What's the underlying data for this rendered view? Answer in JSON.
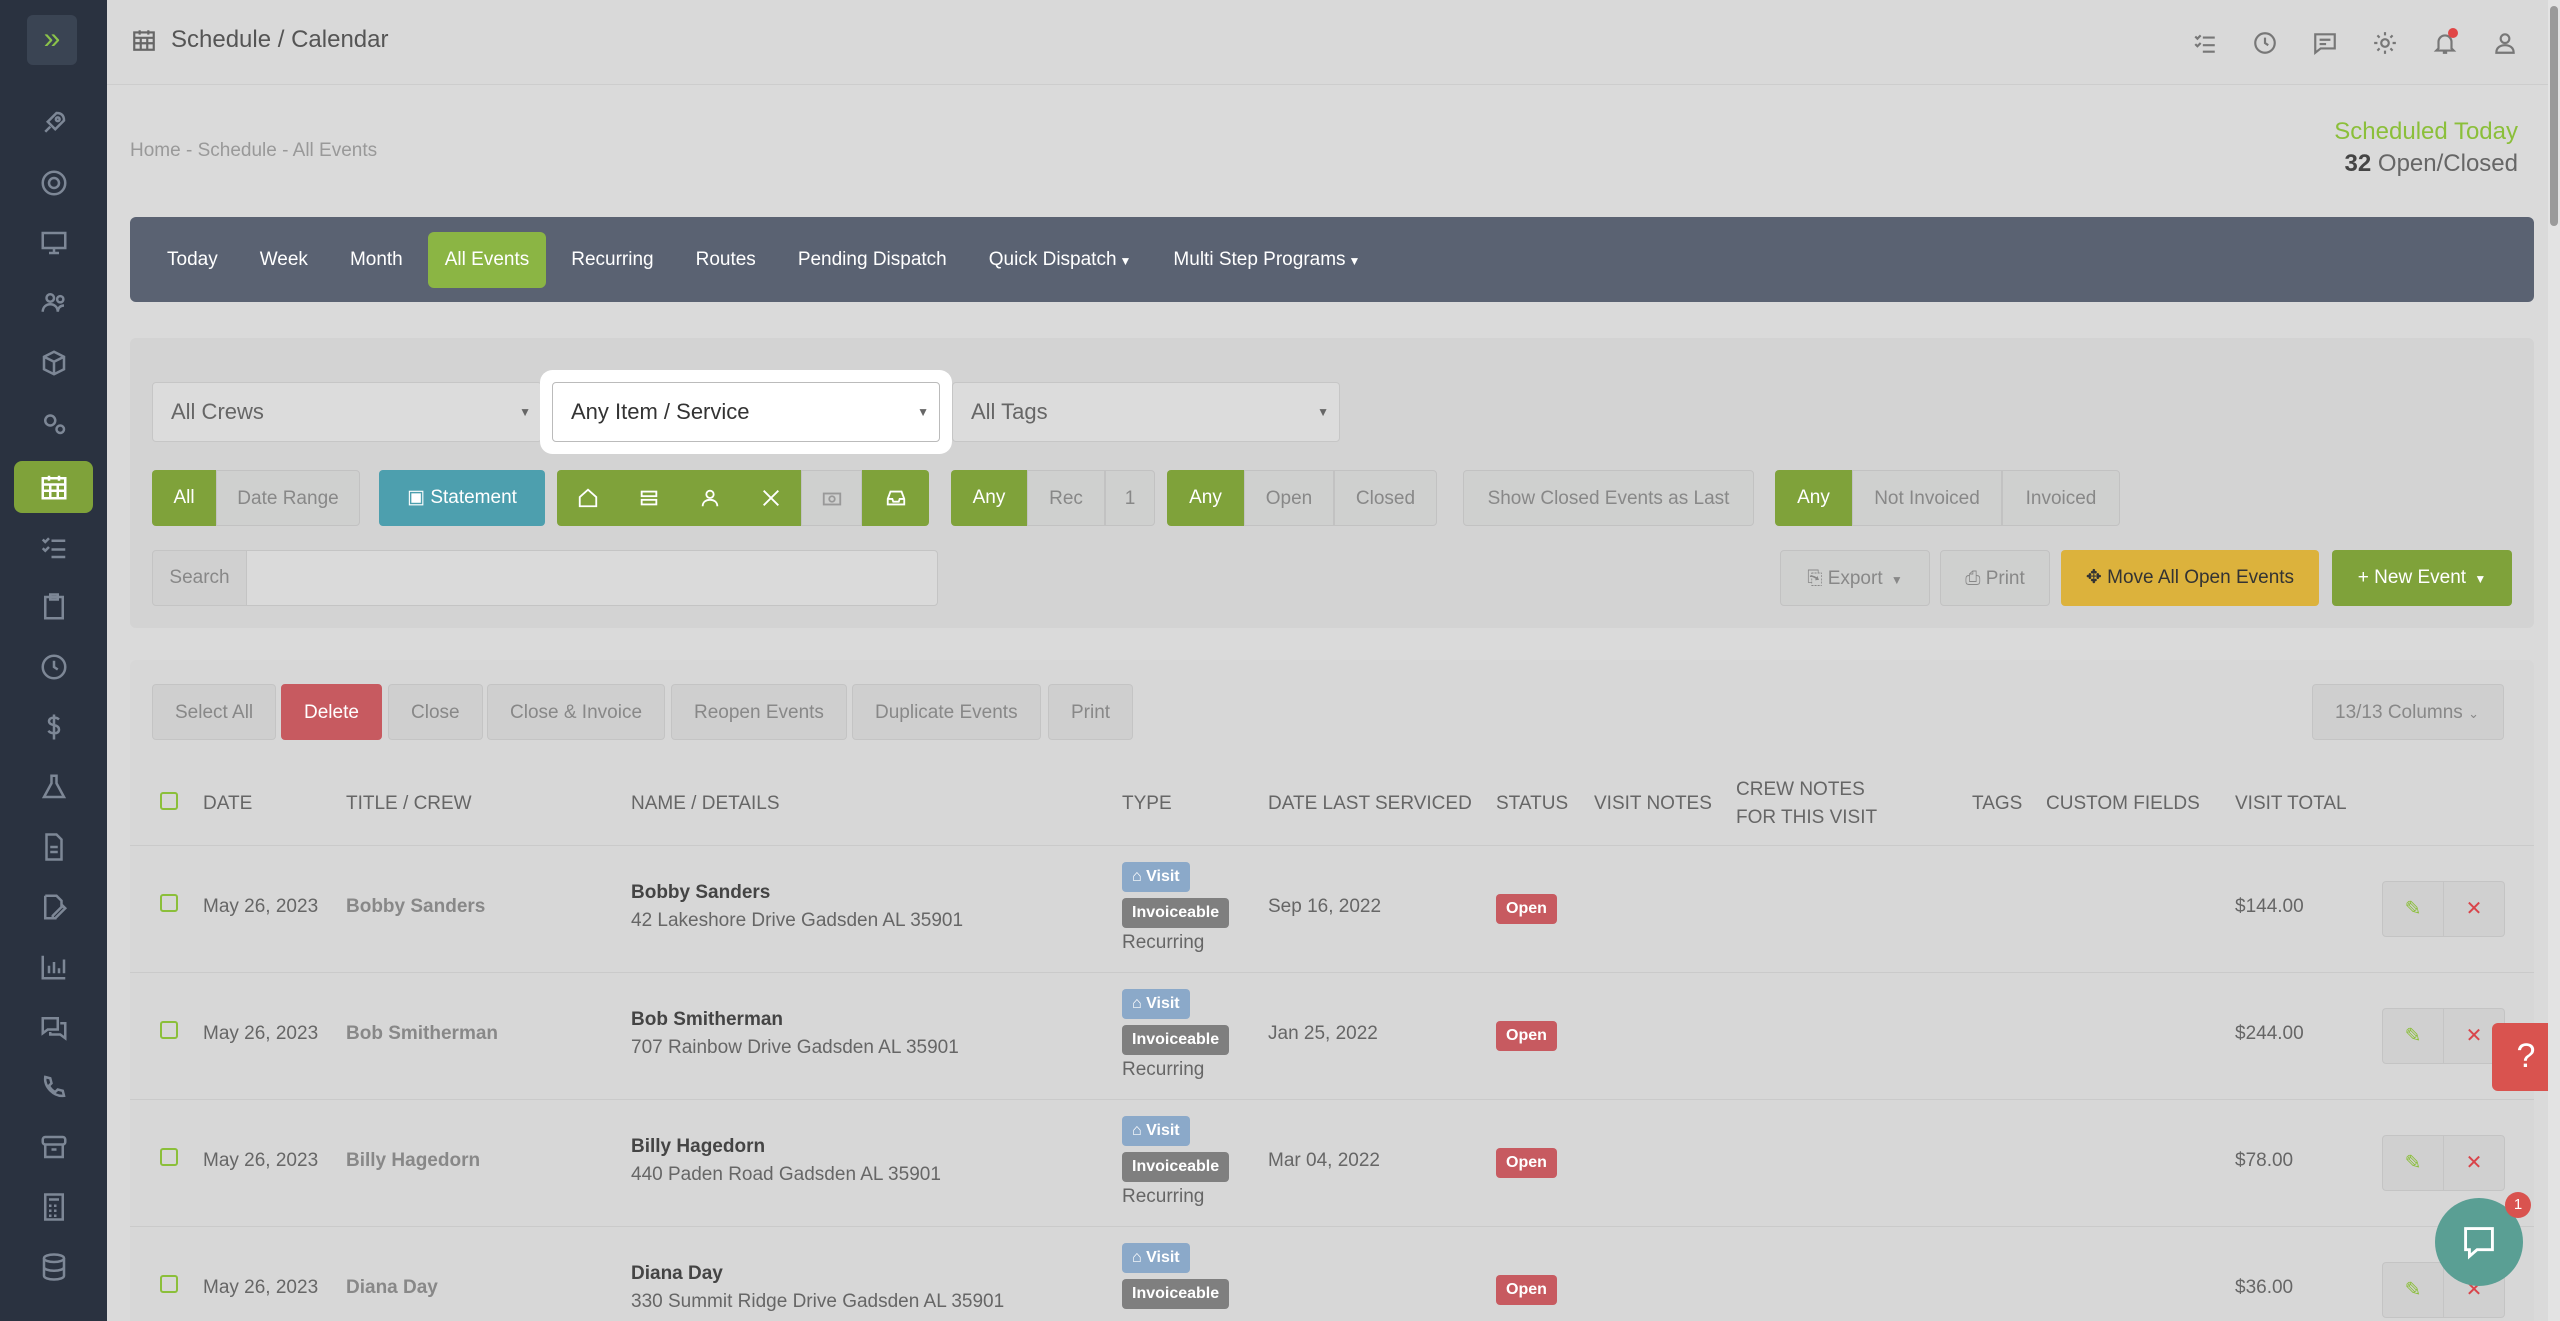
{
  "topbar": {
    "title": "Schedule / Calendar"
  },
  "breadcrumb": {
    "home": "Home",
    "schedule": "Schedule",
    "all_events": "All Events",
    "sep": "-"
  },
  "scheduled": {
    "title": "Scheduled Today",
    "count": "32",
    "label": "Open/Closed"
  },
  "nav": {
    "today": "Today",
    "week": "Week",
    "month": "Month",
    "all_events": "All Events",
    "recurring": "Recurring",
    "routes": "Routes",
    "pending_dispatch": "Pending Dispatch",
    "quick_dispatch": "Quick Dispatch",
    "multi_step": "Multi Step Programs"
  },
  "filters": {
    "crews": "All Crews",
    "item_service": "Any Item / Service",
    "tags": "All Tags",
    "all": "All",
    "date_range": "Date Range",
    "statement": "Statement",
    "rec_any": "Any",
    "rec": "Rec",
    "rec_one": "1",
    "status_any": "Any",
    "status_open": "Open",
    "status_closed": "Closed",
    "show_closed_last": "Show Closed Events as Last",
    "inv_any": "Any",
    "not_invoiced": "Not Invoiced",
    "invoiced": "Invoiced",
    "search_label": "Search",
    "search_value": "",
    "export": "Export",
    "print": "Print",
    "move_all": "Move All Open Events",
    "new_event": "New Event"
  },
  "actions": {
    "select_all": "Select All",
    "delete": "Delete",
    "close": "Close",
    "close_invoice": "Close & Invoice",
    "reopen": "Reopen Events",
    "duplicate": "Duplicate Events",
    "print": "Print",
    "columns": "13/13 Columns"
  },
  "table": {
    "headers": {
      "date": "DATE",
      "title_crew": "TITLE / CREW",
      "name_details": "NAME / DETAILS",
      "type": "TYPE",
      "date_last_serviced": "DATE LAST SERVICED",
      "status": "STATUS",
      "visit_notes": "VISIT NOTES",
      "crew_notes_1": "CREW NOTES",
      "crew_notes_2": "FOR THIS VISIT",
      "tags": "TAGS",
      "custom_fields": "CUSTOM FIELDS",
      "visit_total": "VISIT TOTAL"
    },
    "rows": [
      {
        "date": "May 26, 2023",
        "crew": "Bobby Sanders",
        "name": "Bobby Sanders",
        "address": "42 Lakeshore Drive Gadsden AL 35901",
        "visit": "Visit",
        "invoiceable": "Invoiceable",
        "recurring": "Recurring",
        "last_serviced": "Sep 16, 2022",
        "status": "Open",
        "total": "$144.00"
      },
      {
        "date": "May 26, 2023",
        "crew": "Bob Smitherman",
        "name": "Bob Smitherman",
        "address": "707 Rainbow Drive Gadsden AL 35901",
        "visit": "Visit",
        "invoiceable": "Invoiceable",
        "recurring": "Recurring",
        "last_serviced": "Jan 25, 2022",
        "status": "Open",
        "total": "$244.00"
      },
      {
        "date": "May 26, 2023",
        "crew": "Billy Hagedorn",
        "name": "Billy Hagedorn",
        "address": "440 Paden Road Gadsden AL 35901",
        "visit": "Visit",
        "invoiceable": "Invoiceable",
        "recurring": "Recurring",
        "last_serviced": "Mar 04, 2022",
        "status": "Open",
        "total": "$78.00"
      },
      {
        "date": "May 26, 2023",
        "crew": "Diana Day",
        "name": "Diana Day",
        "address": "330 Summit Ridge Drive Gadsden AL 35901",
        "visit": "Visit",
        "invoiceable": "Invoiceable",
        "recurring": "",
        "last_serviced": "",
        "status": "Open",
        "total": "$36.00"
      }
    ]
  },
  "chat": {
    "badge": "1"
  },
  "colors": {
    "accent": "#7fa23a",
    "sidebar": "#2a3240",
    "nav": "#5a6272",
    "danger": "#c75a60",
    "warning": "#dcb23c",
    "teal": "#4d9fae"
  }
}
